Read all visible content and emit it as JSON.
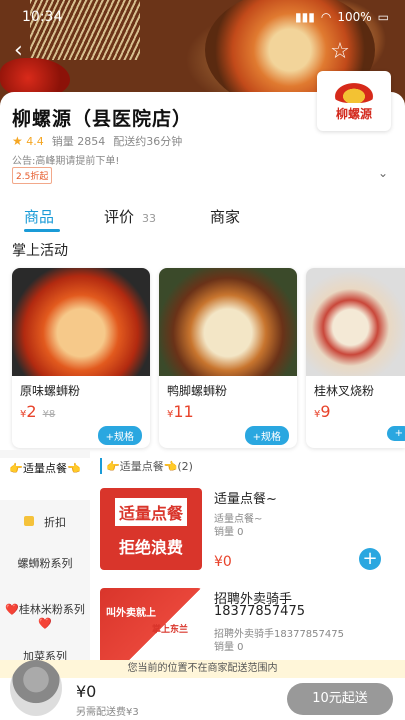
{
  "status": {
    "time": "10:34",
    "battery": "100%"
  },
  "store": {
    "name": "柳螺源（县医院店）",
    "rating": "4.4",
    "sales": "销量 2854",
    "delivery_time": "配送约36分钟",
    "notice": "公告:高峰期请提前下单!",
    "discount": "2.5折起",
    "logo_text": "柳螺源"
  },
  "tabs": [
    {
      "label": "商品"
    },
    {
      "label": "评价",
      "count": "33"
    },
    {
      "label": "商家"
    }
  ],
  "activity": {
    "title": "掌上活动",
    "items": [
      {
        "name": "原味螺蛳粉",
        "currency": "¥",
        "price": "2",
        "old_price": "¥8",
        "spec": "+规格"
      },
      {
        "name": "鸭脚螺蛳粉",
        "currency": "¥",
        "price": "11",
        "spec": "+规格"
      },
      {
        "name": "桂林叉烧粉",
        "currency": "¥",
        "price": "9",
        "spec": "+"
      }
    ]
  },
  "categories": [
    "👉适量点餐👈",
    "折扣",
    "螺蛳粉系列",
    "❤️桂林米粉系列❤️",
    "加菜系列"
  ],
  "list": {
    "header": "👉适量点餐👈(2)",
    "products": [
      {
        "name": "适量点餐~",
        "desc": "适量点餐~",
        "sales": "销量 0",
        "price": "¥0",
        "thumb_line1": "适量点餐",
        "thumb_line2": "拒绝浪费"
      },
      {
        "name": "招聘外卖骑手",
        "name2": "18377857475",
        "desc": "招聘外卖骑手18377857475",
        "sales": "销量 0",
        "thumb_line1": "叫外卖就上",
        "thumb_line2": "掌上东兰"
      }
    ]
  },
  "bottom": {
    "warning": "您当前的位置不在商家配送范围内",
    "total": "¥0",
    "delivery_fee": "另需配送费¥3",
    "checkout": "10元起送"
  }
}
